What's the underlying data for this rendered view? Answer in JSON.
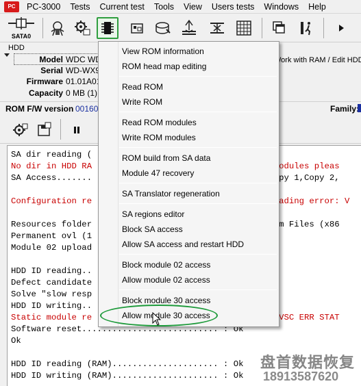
{
  "app": {
    "title": "PC-3000",
    "logo_text": "PC"
  },
  "menubar": {
    "items": [
      {
        "label": "PC-3000"
      },
      {
        "label": "Tests"
      },
      {
        "label": "Current test"
      },
      {
        "label": "Tools"
      },
      {
        "label": "View"
      },
      {
        "label": "Users tests"
      },
      {
        "label": "Windows"
      },
      {
        "label": "Help"
      }
    ]
  },
  "toolbar": {
    "sata_label": "SATA0",
    "icons": [
      "bug-icon",
      "gear-icon",
      "rom-chip-icon",
      "drive-icon",
      "disk-icon",
      "heads-icon",
      "transfer-icon",
      "grid-icon",
      "windows-icon",
      "run-icon",
      "play-icon"
    ]
  },
  "hdd": {
    "legend": "HDD",
    "model_label": "Model",
    "model_value": "WDC WD",
    "serial_label": "Serial",
    "serial_value": "WD-WX9",
    "firmware_label": "Firmware",
    "firmware_value": "01.01A01",
    "capacity_label": "Capacity",
    "capacity_value": "0 MB (1)"
  },
  "right_panel": {
    "text": "Work with RAM / Edit HDD"
  },
  "fw_bar": {
    "label": "ROM F/W version",
    "value": "001600",
    "family_label": "Family:"
  },
  "log": {
    "lines": [
      {
        "text": "SA dir reading (",
        "red": false
      },
      {
        "text": "No dir in HDD RA                                  A modules pleas",
        "red": true
      },
      {
        "text": "SA Access.......                                  ,Copy 1,Copy 2,",
        "red": false
      },
      {
        "text": "",
        "red": false
      },
      {
        "text": "Configuration re                                   reading error: V",
        "red": true
      },
      {
        "text": "",
        "red": false
      },
      {
        "text": "Resources folder                                  gram Files (x86",
        "red": false
      },
      {
        "text": "Permanent ovl (1",
        "red": false
      },
      {
        "text": "Module 02 upload",
        "red": false
      },
      {
        "text": "",
        "red": false
      },
      {
        "text": "HDD ID reading..",
        "red": false
      },
      {
        "text": "Defect candidate",
        "red": false
      },
      {
        "text": "Solve \"slow resp",
        "red": false
      },
      {
        "text": "HDD ID writing..",
        "red": false
      },
      {
        "text": "Static module re                                  : \"VSC ERR STAT",
        "red": true
      },
      {
        "text": "Software reset........................... : Ok",
        "red": false
      },
      {
        "text": "Ok",
        "red": false
      },
      {
        "text": "",
        "red": false
      },
      {
        "text": "HDD ID reading (RAM)..................... : Ok",
        "red": false
      },
      {
        "text": "HDD ID writing (RAM)..................... : Ok",
        "red": false
      }
    ]
  },
  "dropdown": {
    "items": [
      {
        "label": "View ROM information",
        "group": 0
      },
      {
        "label": "ROM head map editing",
        "group": 0
      },
      {
        "label": "Read ROM",
        "group": 1
      },
      {
        "label": "Write ROM",
        "group": 1
      },
      {
        "label": "Read ROM modules",
        "group": 2
      },
      {
        "label": "Write ROM modules",
        "group": 2
      },
      {
        "label": "ROM build from SA data",
        "group": 3
      },
      {
        "label": "Module 47 recovery",
        "group": 3
      },
      {
        "label": "SA Translator regeneration",
        "group": 4
      },
      {
        "label": "SA regions editor",
        "group": 5
      },
      {
        "label": "Block SA access",
        "group": 5
      },
      {
        "label": "Allow SA access and restart HDD",
        "group": 5
      },
      {
        "label": "Block module 02 access",
        "group": 6
      },
      {
        "label": "Allow module 02 access",
        "group": 6
      },
      {
        "label": "Block module 30 access",
        "group": 7
      },
      {
        "label": "Allow module 30 access",
        "group": 7
      }
    ],
    "highlighted_item": "Allow module 30 access"
  },
  "watermark": {
    "line1": "盘首数据恢复",
    "line2": "18913587620"
  },
  "colors": {
    "highlight_green": "#1d9a3a",
    "error_red": "#c80000",
    "link_blue": "#1a2fa0"
  }
}
